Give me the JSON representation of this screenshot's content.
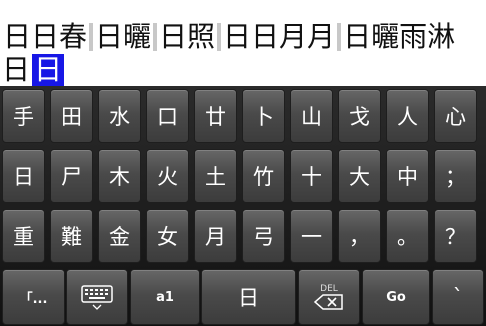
{
  "composer": {
    "candidates": [
      "日日春",
      "日曬",
      "日照",
      "日日月月",
      "日曬雨淋"
    ],
    "input_text": "日",
    "input_selected": "日"
  },
  "keyboard": {
    "row1": [
      "手",
      "田",
      "水",
      "口",
      "廿",
      "卜",
      "山",
      "戈",
      "人",
      "心"
    ],
    "row2": [
      "日",
      "尸",
      "木",
      "火",
      "土",
      "竹",
      "十",
      "大",
      "中",
      "；"
    ],
    "row3": [
      "重",
      "難",
      "金",
      "女",
      "月",
      "弓",
      "一",
      "，",
      "。",
      "？"
    ],
    "row4": {
      "punct_label": "「...",
      "keyboard_icon": "keyboard-icon",
      "mode_label": "a1",
      "space_label": "日",
      "del_label": "DEL",
      "go_label": "Go",
      "last_label": "`"
    }
  },
  "colors": {
    "selection": "#1717e6",
    "key_face": "#4a4a4a"
  }
}
